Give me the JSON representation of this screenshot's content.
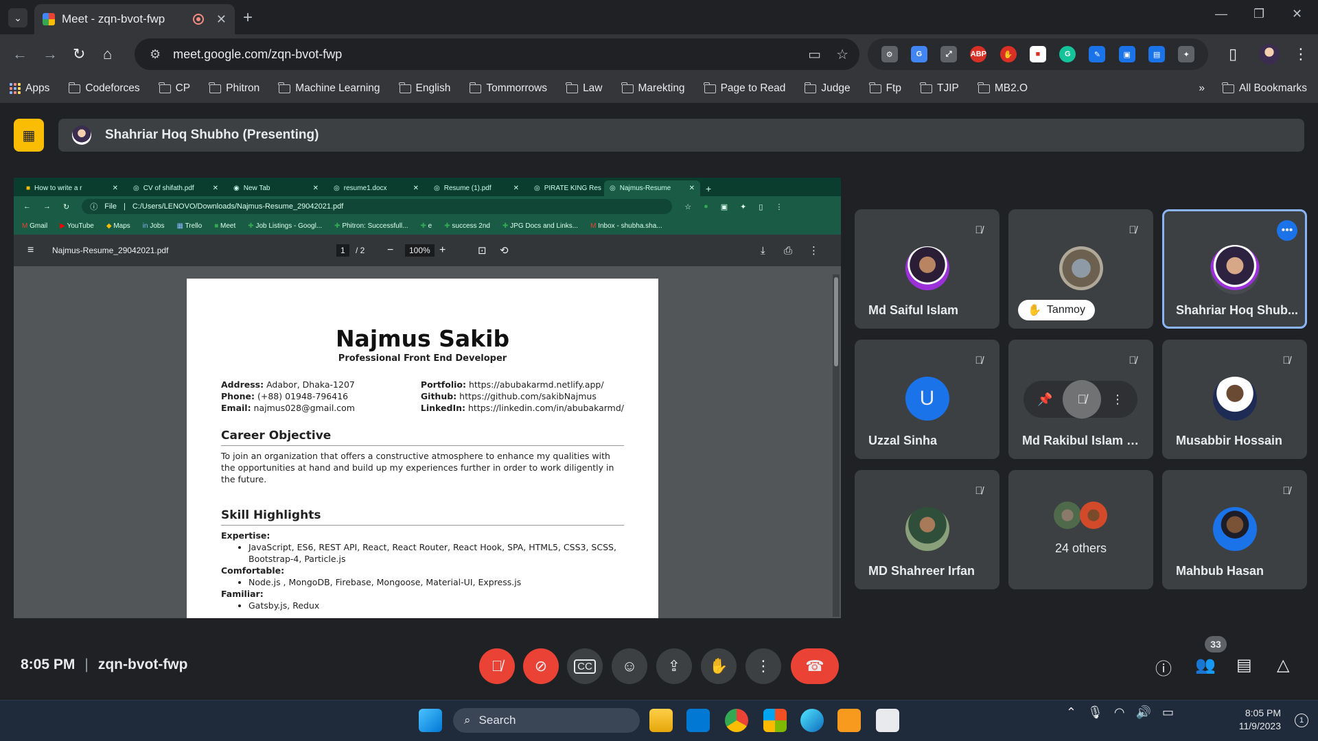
{
  "browser": {
    "tab_title": "Meet - zqn-bvot-fwp",
    "url": "meet.google.com/zqn-bvot-fwp",
    "bookmarks": [
      "Apps",
      "Codeforces",
      "CP",
      "Phitron",
      "Machine Learning",
      "English",
      "Tommorrows",
      "Law",
      "Marekting",
      "Page to Read",
      "Judge",
      "Ftp",
      "TJIP",
      "MB2.O"
    ],
    "all_bookmarks": "All Bookmarks",
    "more_glyph": "»"
  },
  "meet": {
    "presenter_label": "Shahriar Hoq Shubho (Presenting)",
    "meeting_time": "8:05 PM",
    "meeting_code": "zqn-bvot-fwp",
    "participant_count": "33",
    "participants": [
      {
        "name": "Md Saiful Islam",
        "muted": true
      },
      {
        "name": "Tanmoy",
        "muted": true,
        "hand_raised": true
      },
      {
        "name": "Shahriar Hoq Shub...",
        "muted": false,
        "selected": true
      },
      {
        "name": "Uzzal Sinha",
        "muted": true,
        "initial": "U"
      },
      {
        "name": "Md Rakibul Islam R...",
        "muted": true
      },
      {
        "name": "Musabbir Hossain",
        "muted": true
      },
      {
        "name": "MD Shahreer Irfan",
        "muted": true
      },
      {
        "name": "24 others"
      },
      {
        "name": "Mahbub Hasan",
        "muted": true
      }
    ]
  },
  "shared": {
    "tabs": [
      "How to write a r",
      "CV of shifath.pdf",
      "New Tab",
      "resume1.docx",
      "Resume (1).pdf",
      "PIRATE KING Res",
      "Najmus-Resume"
    ],
    "file_label": "File",
    "path": "C:/Users/LENOVO/Downloads/Najmus-Resume_29042021.pdf",
    "bookmarks": [
      "Gmail",
      "YouTube",
      "Maps",
      "Jobs",
      "Trello",
      "Meet",
      "Job Listings - Googl...",
      "Phitron: Successfull...",
      "e",
      "success 2nd",
      "JPG Docs and Links...",
      "Inbox - shubha.sha..."
    ],
    "pdf_title": "Najmus-Resume_29042021.pdf",
    "page_current": "1",
    "page_total": "/ 2",
    "zoom": "100%",
    "resume": {
      "name": "Najmus Sakib",
      "role": "Professional Front End Developer",
      "address_label": "Address:",
      "address": " Adabor, Dhaka-1207",
      "phone_label": "Phone:",
      "phone": " (+88) 01948-796416",
      "email_label": "Email:",
      "email": " najmus028@gmail.com",
      "portfolio_label": "Portfolio:",
      "portfolio": " https://abubakarmd.netlify.app/",
      "github_label": "Github:",
      "github": " https://github.com/sakibNajmus",
      "linkedin_label": "LinkedIn:",
      "linkedin": " https://linkedin.com/in/abubakarmd/",
      "career_heading": "Career Objective",
      "career_text": "To join an organization that offers a constructive atmosphere to enhance my qualities with the opportunities at hand and build up my experiences further in order to work diligently in the future.",
      "skills_heading": "Skill Highlights",
      "expertise_label": "Expertise:",
      "expertise": "JavaScript, ES6, REST API, React, React Router, React Hook, SPA, HTML5, CSS3, SCSS, Bootstrap-4, Particle.js",
      "comfortable_label": "Comfortable:",
      "comfortable": "Node.js , MongoDB, Firebase, Mongoose, Material-UI, Express.js",
      "familiar_label": "Familiar:",
      "familiar": "Gatsby.js, Redux"
    }
  },
  "taskbar": {
    "search_placeholder": "Search",
    "time": "8:05 PM",
    "date": "11/9/2023",
    "notif": "1"
  },
  "colors": {
    "accent": "#8ab4f8",
    "danger": "#ea4335",
    "presenting": "#fbbc04"
  }
}
